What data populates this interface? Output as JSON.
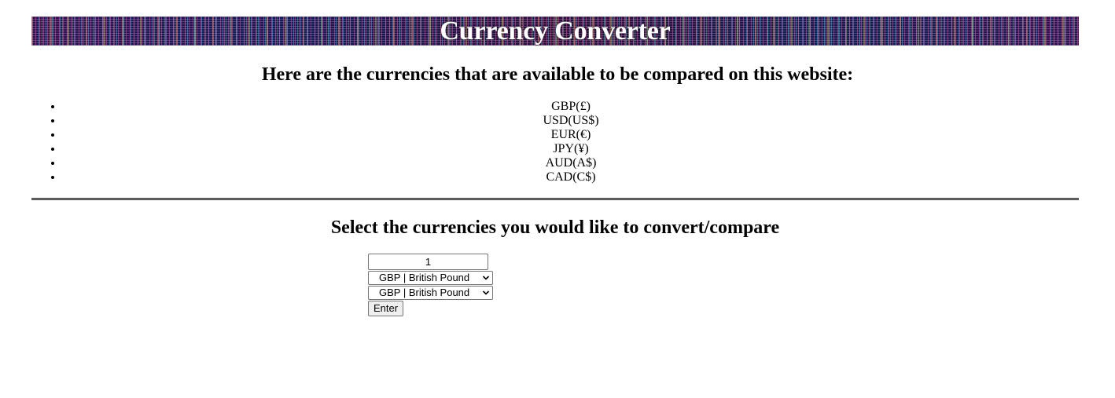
{
  "header": {
    "title": "Currency Converter"
  },
  "available": {
    "heading": "Here are the currencies that are available to be compared on this website:",
    "items": [
      "GBP(£)",
      "USD(US$)",
      "EUR(€)",
      "JPY(¥)",
      "AUD(A$)",
      "CAD(C$)"
    ]
  },
  "converter": {
    "heading": "Select the currencies you would like to convert/compare",
    "amount_value": "1",
    "from_selected": "GBP | British Pound",
    "to_selected": "GBP | British Pound",
    "enter_label": "Enter"
  }
}
